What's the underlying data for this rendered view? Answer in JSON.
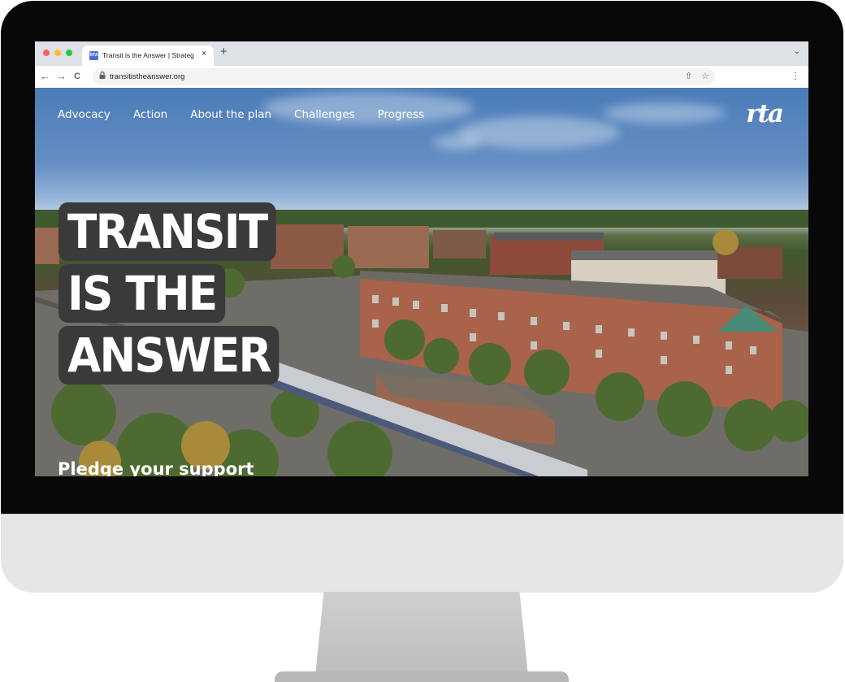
{
  "browser": {
    "tab_title": "Transit is the Answer | Strateg",
    "tab_close": "×",
    "new_tab": "+",
    "tab_menu": "⌄",
    "back": "←",
    "forward": "→",
    "reload": "C",
    "lock": "🔒",
    "url": "transitistheanswer.org",
    "share_icon": "⇧",
    "star_icon": "☆",
    "menu_icon": "⋮",
    "favicon_text": "RTA"
  },
  "site": {
    "logo": "rta",
    "nav": [
      "Advocacy",
      "Action",
      "About the plan",
      "Challenges",
      "Progress"
    ],
    "headline": [
      "TRANSIT",
      "IS THE",
      "ANSWER"
    ],
    "pledge": "Pledge your support"
  },
  "colors": {
    "bezel": "#080808",
    "chin": "#e6e6e6",
    "headline_bg": "#3a3a3a",
    "sky": "#4a7bb8"
  }
}
